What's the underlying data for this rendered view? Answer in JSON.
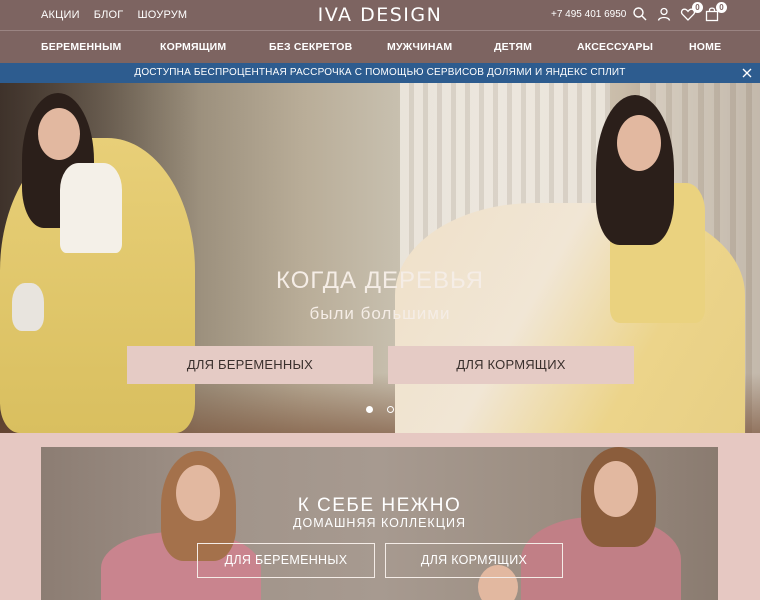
{
  "header": {
    "links": [
      "АКЦИИ",
      "БЛОГ",
      "ШОУРУМ"
    ],
    "logo": "IVA DESIGN",
    "phone": "+7 495 401 6950",
    "wishlist_count": "0",
    "cart_count": "0"
  },
  "nav": {
    "items": [
      "БЕРЕМЕННЫМ",
      "КОРМЯЩИМ",
      "БЕЗ СЕКРЕТОВ",
      "МУЖЧИНАМ",
      "ДЕТЯМ",
      "АКСЕССУАРЫ",
      "HOME"
    ]
  },
  "promo": {
    "text": "ДОСТУПНА БЕСПРОЦЕНТНАЯ РАССРОЧКА С ПОМОЩЬЮ СЕРВИСОВ ДОЛЯМИ И ЯНДЕКС СПЛИТ"
  },
  "hero": {
    "title": "КОГДА ДЕРЕВЬЯ",
    "subtitle": "были большими",
    "buttons": [
      "ДЛЯ БЕРЕМЕННЫХ",
      "ДЛЯ КОРМЯЩИХ"
    ],
    "slide_count": 2,
    "active_slide": 1
  },
  "banner2": {
    "title": "К СЕБЕ НЕЖНО",
    "subtitle": "ДОМАШНЯЯ КОЛЛЕКЦИЯ",
    "buttons": [
      "ДЛЯ БЕРЕМЕННЫХ",
      "ДЛЯ КОРМЯЩИХ"
    ]
  },
  "colors": {
    "header_bg": "#7d6461",
    "promo_bg": "#2d5c8f",
    "button_bg": "#e5cbc5",
    "page_bg": "#e6c8c2"
  }
}
